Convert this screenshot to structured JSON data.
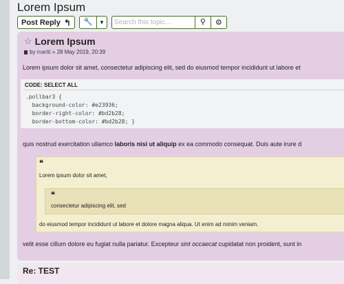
{
  "topic_title": "Lorem Ipsum",
  "actionbar": {
    "post_reply_label": "Post Reply",
    "reply_icon": "reply-icon",
    "tools_icon": "wrench-icon",
    "search_placeholder": "Search this topic...",
    "search_icon": "search-icon",
    "settings_icon": "gear-icon"
  },
  "post1": {
    "title": "Lorem Ipsum",
    "byline_prefix": "by ",
    "author": "martti",
    "date": " » 28 May 2019, 20:39",
    "intro": "Lorem ipsum dolor sit amet, consectetur adipiscing elit, sed do eiusmod tempor incididunt ut labore et",
    "code": {
      "header": "CODE: SELECT ALL",
      "lines": [
        ".pollbar3 {",
        "  background-color: #e23936;",
        "  border-right-color: #bd2b28;",
        "  border-bottom-color: #bd2b28; }"
      ]
    },
    "para2_a": "quis nostrud exercitation ullamco ",
    "para2_b": "laboris nisi ut aliquip",
    "para2_c": " ex ea commodo consequat. Duis aute irure d",
    "quote": {
      "line1": "Lorem ipsum dolor sit amet,",
      "nested": "consectetur adipiscing elit, sed",
      "line2": "do eiusmod tempor incididunt ut labore et dolore magna aliqua. Ut enim ad minim veniam."
    },
    "para3_a": "velit esse cillum dolore eu fugiat nulla pariatur. Excepteur ",
    "para3_b": "sint occaecat",
    "para3_c": " cupidatat non proident, sunt in"
  },
  "post2": {
    "title": "Re: TEST"
  },
  "colors": {
    "post_bg": "#e4cee3",
    "quote_bg": "#f4efd0",
    "nested_quote_bg": "#e8e1b8",
    "button_border": "#4b6b2f"
  }
}
